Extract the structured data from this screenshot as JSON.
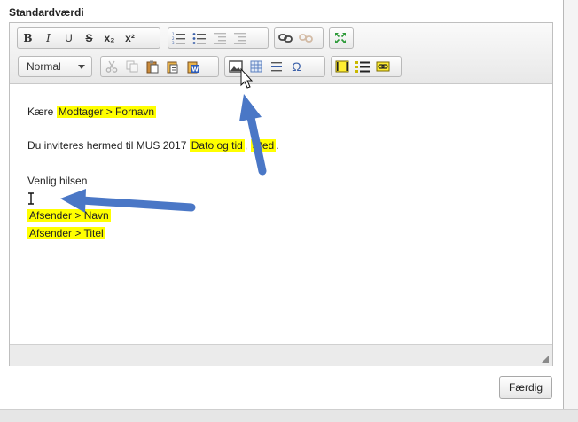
{
  "panel": {
    "title": "Standardværdi"
  },
  "toolbar": {
    "row1": {
      "bold": "B",
      "italic": "I",
      "underline": "U",
      "strike": "S",
      "subscript": "x₂",
      "superscript": "x²"
    },
    "format_select": {
      "value": "Normal"
    },
    "special_char": "Ω"
  },
  "content": {
    "greeting": "Kære",
    "recipient_field": "Modtager > Fornavn",
    "invite_text": "Du inviteres hermed til MUS 2017",
    "date_field": "Dato og tid",
    "comma": ",",
    "place_field": "Sted",
    "period": ".",
    "closing": "Venlig hilsen",
    "sender_name_field": "Afsender > Navn",
    "sender_title_field": "Afsender > Titel"
  },
  "footer": {
    "done_label": "Færdig"
  },
  "colors": {
    "highlight": "#ffff00",
    "arrow": "#4a77c6"
  }
}
